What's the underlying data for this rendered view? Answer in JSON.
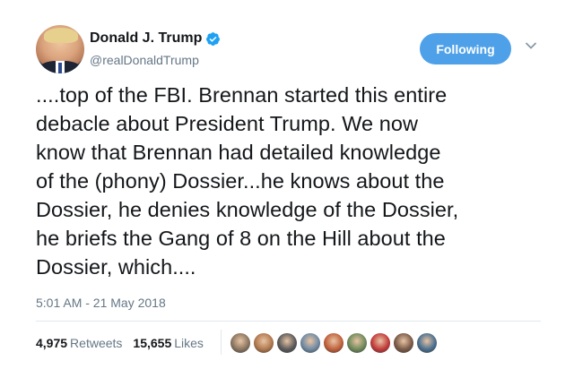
{
  "user": {
    "display_name": "Donald J. Trump",
    "handle": "@realDonaldTrump",
    "verified": true,
    "verified_color": "#1da1f2"
  },
  "follow_button": {
    "label": "Following",
    "color": "#4ea1e8"
  },
  "menu_icon": "chevron-down-icon",
  "tweet": {
    "lines": [
      "....top of the FBI. Brennan started this entire",
      "debacle about President Trump. We now",
      "know that Brennan had detailed knowledge",
      "of the (phony) Dossier...he knows about the",
      "Dossier, he denies knowledge of the Dossier,",
      "he briefs the Gang of 8 on the Hill about the",
      "Dossier, which...."
    ],
    "timestamp": "5:01 AM - 21 May 2018"
  },
  "stats": {
    "retweets_count": "4,975",
    "retweets_label": "Retweets",
    "likes_count": "15,655",
    "likes_label": "Likes"
  },
  "liker_avatars": [
    {
      "name": "liker-avatar-1",
      "color": "#8a7560"
    },
    {
      "name": "liker-avatar-2",
      "color": "#b0784e"
    },
    {
      "name": "liker-avatar-3",
      "color": "#5a5a5a"
    },
    {
      "name": "liker-avatar-4",
      "color": "#6f8aa4"
    },
    {
      "name": "liker-avatar-5",
      "color": "#c0603a"
    },
    {
      "name": "liker-avatar-6",
      "color": "#6e8a5a"
    },
    {
      "name": "liker-avatar-7",
      "color": "#c23a3a"
    },
    {
      "name": "liker-avatar-8",
      "color": "#7a5a48"
    },
    {
      "name": "liker-avatar-9",
      "color": "#4a6f8f"
    }
  ]
}
